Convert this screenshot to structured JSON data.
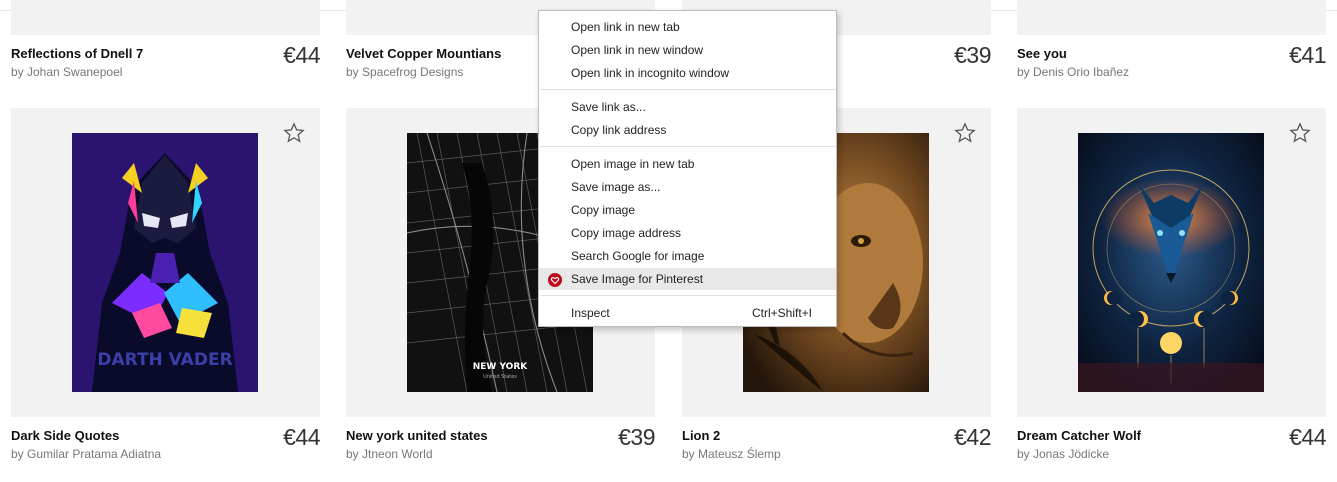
{
  "top_row": [
    {
      "title": "Reflections of Dnell 7",
      "artist": "by Johan Swanepoel",
      "price": "€44"
    },
    {
      "title": "Velvet Copper Mountians",
      "artist": "by Spacefrog Designs",
      "price": ""
    },
    {
      "title": "",
      "artist": "",
      "price": "€39"
    },
    {
      "title": "See you",
      "artist": "by Denis Orio Ibañez",
      "price": "€41"
    }
  ],
  "products": [
    {
      "title": "Dark Side Quotes",
      "artist": "by Gumilar Pratama Adiatna",
      "price": "€44",
      "poster_text": "DARTH VADER"
    },
    {
      "title": "New york united states",
      "artist": "by Jtneon World",
      "price": "€39",
      "poster_text": "NEW YORK",
      "poster_sub": "United States"
    },
    {
      "title": "Lion 2",
      "artist": "by Mateusz Ślemp",
      "price": "€42"
    },
    {
      "title": "Dream Catcher Wolf",
      "artist": "by Jonas Jödicke",
      "price": "€44"
    }
  ],
  "context_menu": {
    "items": [
      {
        "label": "Open link in new tab"
      },
      {
        "label": "Open link in new window"
      },
      {
        "label": "Open link in incognito window"
      },
      {
        "label": "Save link as..."
      },
      {
        "label": "Copy link address"
      },
      {
        "label": "Open image in new tab"
      },
      {
        "label": "Save image as..."
      },
      {
        "label": "Copy image"
      },
      {
        "label": "Copy image address"
      },
      {
        "label": "Search Google for image"
      },
      {
        "label": "Save Image for Pinterest",
        "icon": "pinterest-icon",
        "highlighted": true
      },
      {
        "label": "Inspect",
        "shortcut": "Ctrl+Shift+I"
      }
    ]
  },
  "colors": {
    "card_bg": "#f2f2f2",
    "pinterest": "#bd081c",
    "highlight": "#e8e8e8"
  }
}
